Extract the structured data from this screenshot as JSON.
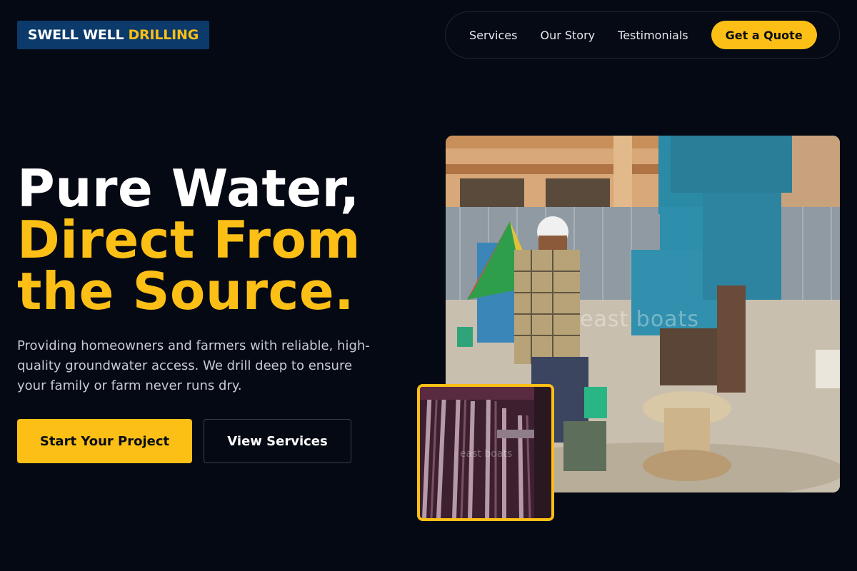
{
  "brand": {
    "name_part1": "SWELL WELL",
    "name_part2": "DRILLING"
  },
  "nav": {
    "links": [
      "Services",
      "Our Story",
      "Testimonials"
    ],
    "cta_label": "Get a Quote"
  },
  "hero": {
    "title_line1": "Pure Water,",
    "title_line2": "Direct From",
    "title_line3": "the Source.",
    "subtitle": "Providing homeowners and farmers with reliable, high-quality groundwater access. We drill deep to ensure your family or farm never runs dry.",
    "primary_button": "Start Your Project",
    "secondary_button": "View Services"
  },
  "images": {
    "main_watermark": "east boats",
    "inset_watermark": "east boats"
  },
  "colors": {
    "background": "#050913",
    "accent": "#fbbf16",
    "logo_bg": "#0b3a6b"
  }
}
